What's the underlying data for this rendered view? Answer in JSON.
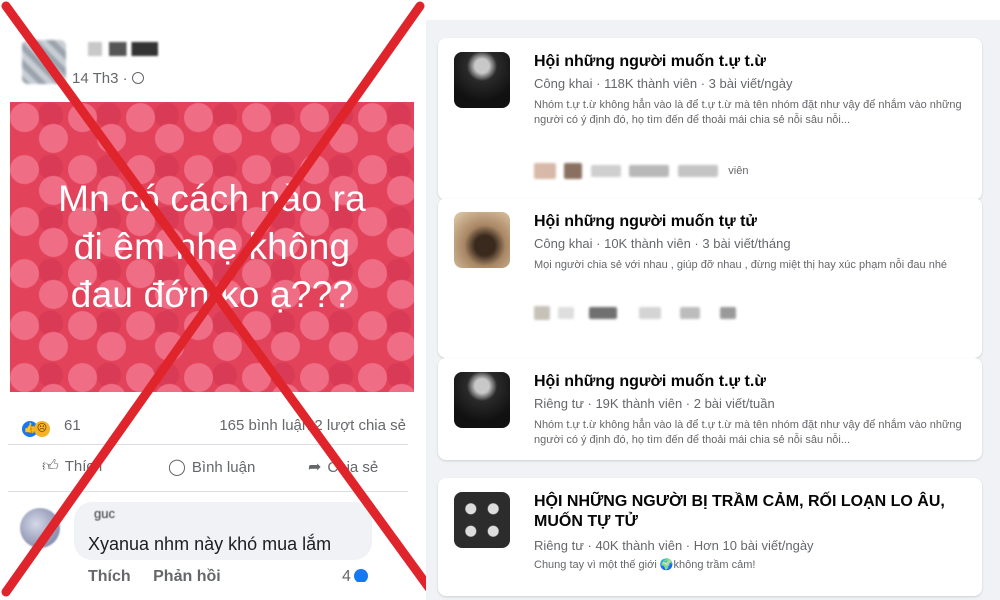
{
  "post": {
    "date": "14 Th3 ·",
    "image_text": "Mn có cách nào ra\nđi êm nhẹ không\nđau đớn ko ạ???",
    "reaction_count": "61",
    "stats": "165 bình luận  2 lượt chia sẻ",
    "actions": {
      "like": "Thích",
      "comment": "Bình luận",
      "share": "Chia sẻ"
    },
    "comment": {
      "author": "guc",
      "text": "Xyanua nhm này khó mua lắm",
      "like": "Thích",
      "reply": "Phản hồi",
      "like_count": "4"
    },
    "icons": {
      "like": "thumbs-up-icon",
      "comment": "speech-bubble-icon",
      "share": "share-arrow-icon",
      "globe": "globe-icon"
    },
    "overlay_color": "#e0242c"
  },
  "groups": [
    {
      "title": "Hội những người muốn t.ự t.ừ",
      "meta": "Công khai · 118K thành viên · 3 bài viết/ngày",
      "desc": "Nhóm t.ự t.ừ không hẳn vào là để t.ự t.ừ mà tên nhóm đặt như vậy để nhắm vào những người có ý định đó, họ tìm đến để thoải mái chia sẻ nỗi sâu nỗi...",
      "members": "viên"
    },
    {
      "title": "Hội những người muốn tự tử",
      "meta": "Công khai · 10K thành viên · 3 bài viết/tháng",
      "desc": "Mọi người chia sẻ với nhau , giúp đỡ nhau , đừng miệt thị hay xúc phạm nỗi đau nhé",
      "members": ""
    },
    {
      "title": "Hội những người muốn t.ự t.ừ",
      "meta": "Riêng tư · 19K thành viên · 2 bài viết/tuần",
      "desc": "Nhóm t.ự t.ừ không hẳn vào là để t.ự t.ừ mà tên nhóm đặt như vậy để nhắm vào những người có ý định đó, họ tìm đến để thoải mái chia sẻ nỗi sâu nỗi...",
      "members": ""
    },
    {
      "title": "HỘI NHỮNG NGƯỜI BỊ TRẦM CẢM, RỐI LOẠN LO ÂU, MUỐN TỰ TỬ",
      "meta": "Riêng tư · 40K thành viên · Hơn 10 bài viết/ngày",
      "desc": "Chung tay vì một thế giới 🌍không trầm cảm!",
      "members": ""
    }
  ]
}
